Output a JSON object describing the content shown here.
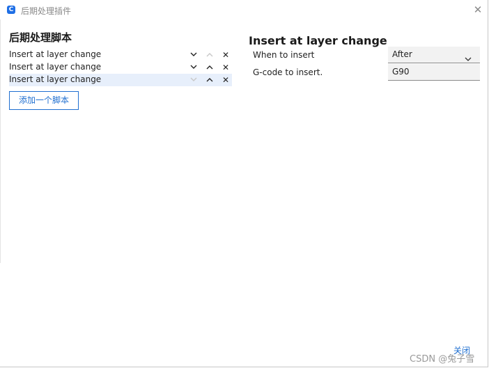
{
  "window": {
    "title": "后期处理插件",
    "app_icon_letter": "C",
    "close_glyph": "✕"
  },
  "scripts": {
    "heading": "后期处理脚本",
    "items": [
      {
        "label": "Insert at layer change",
        "selected": false,
        "move_down_enabled": true,
        "move_up_enabled": false
      },
      {
        "label": "Insert at layer change",
        "selected": false,
        "move_down_enabled": true,
        "move_up_enabled": true
      },
      {
        "label": "Insert at layer change",
        "selected": true,
        "move_down_enabled": false,
        "move_up_enabled": true
      }
    ],
    "delete_glyph": "✕",
    "add_button_label": "添加一个脚本"
  },
  "detail": {
    "title": "Insert at layer change",
    "when_label": "When to insert",
    "when_value": "After",
    "gcode_label": "G-code to insert.",
    "gcode_value": "G90"
  },
  "footer": {
    "close_label": "关闭"
  },
  "watermark": "CSDN @兔子雪",
  "colors": {
    "accent": "#1f6fd0",
    "selected_row": "#e7effb",
    "field_bg": "#f2f2f2"
  }
}
